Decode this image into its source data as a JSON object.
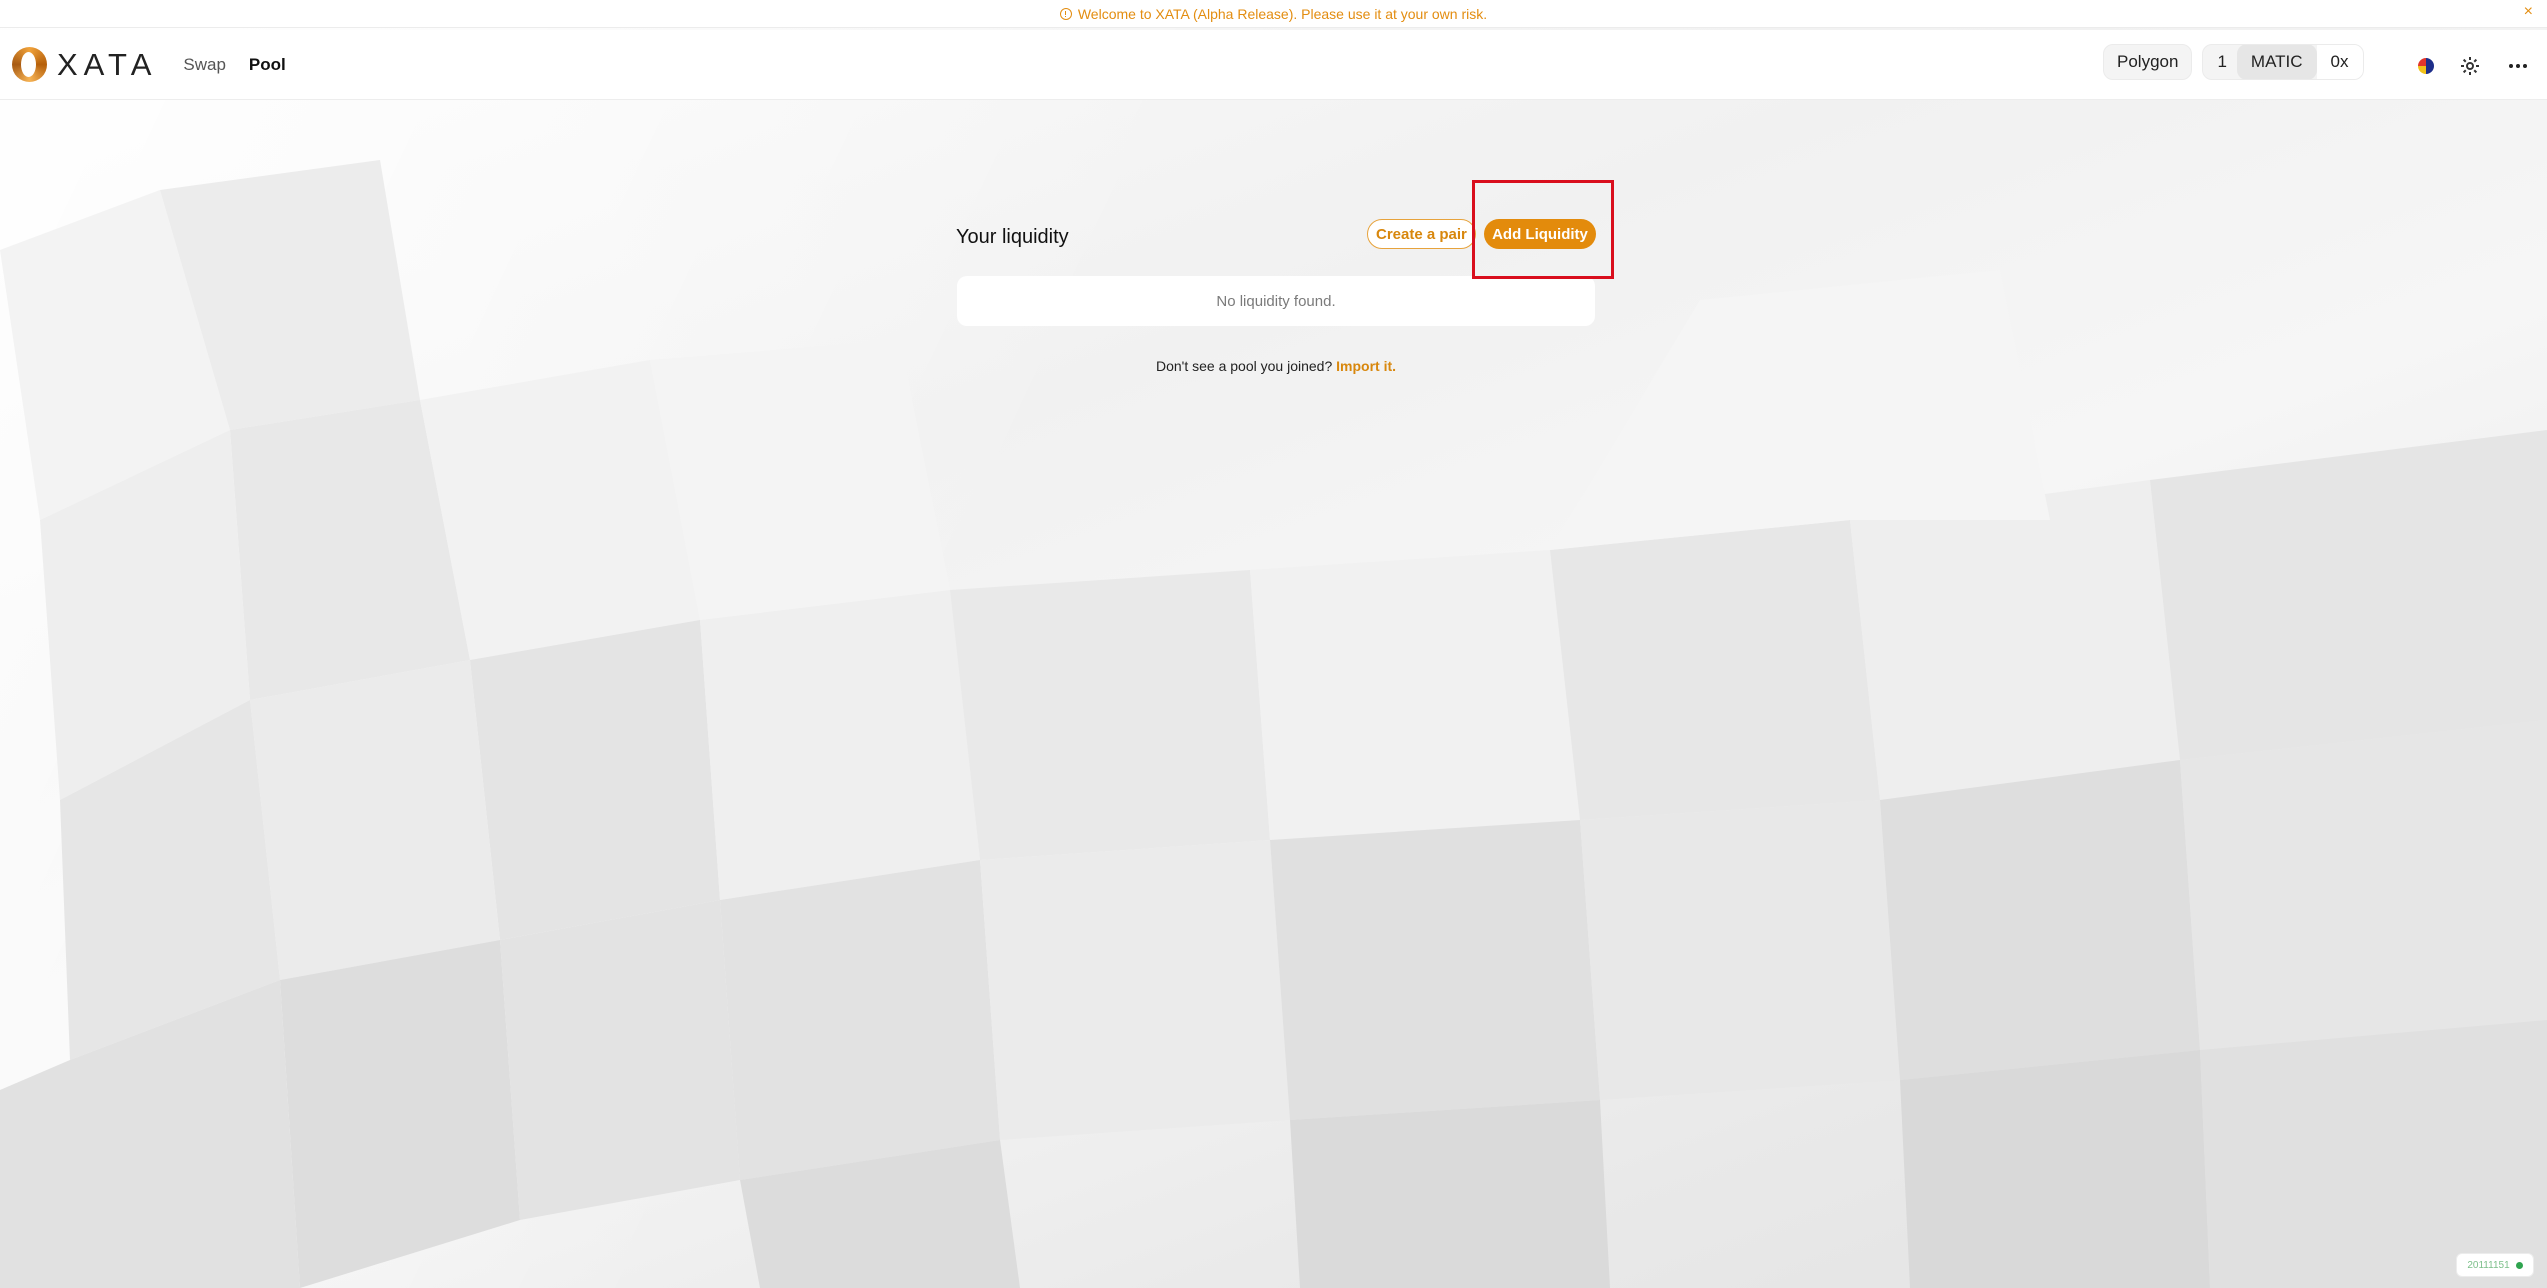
{
  "banner": {
    "message": "Welcome to XATA (Alpha Release). Please use it at your own risk.",
    "close_glyph": "×",
    "color": "#e38d10"
  },
  "header": {
    "logo_text": "XATA",
    "nav": [
      {
        "label": "Swap",
        "active": false
      },
      {
        "label": "Pool",
        "active": true
      }
    ],
    "network": "Polygon",
    "balance": "1",
    "currency": "MATIC",
    "address": "0x",
    "icons": [
      "language-icon",
      "theme-sun-icon",
      "more-icon"
    ]
  },
  "pool": {
    "title": "Your liquidity",
    "create_pair_label": "Create a pair",
    "add_liquidity_label": "Add Liquidity",
    "empty_message": "No liquidity found.",
    "import_prompt": "Don't see a pool you joined?",
    "import_link": "Import it."
  },
  "status": {
    "block_number": "20111151",
    "indicator_color": "#2fa44f"
  },
  "colors": {
    "accent": "#e38b0c",
    "highlight": "#d90e1d"
  }
}
